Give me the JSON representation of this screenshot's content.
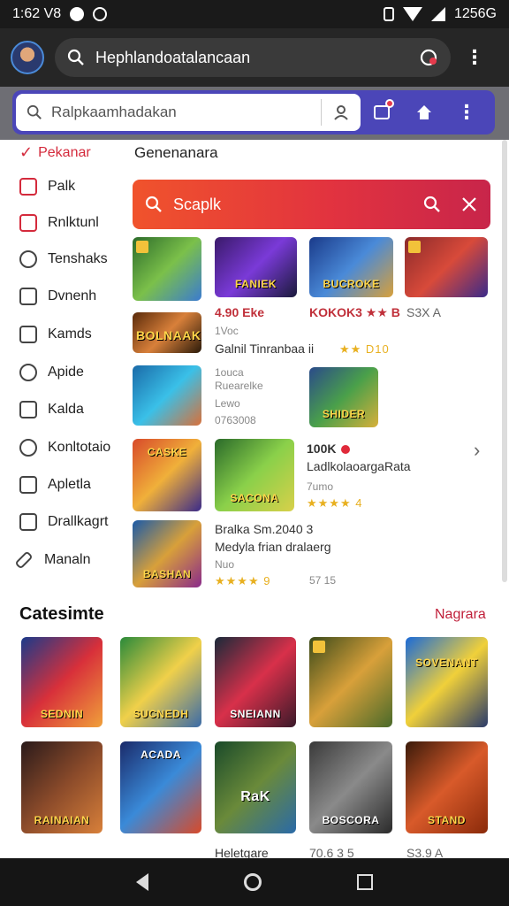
{
  "status_bar": {
    "time": "1:62 V8",
    "battery_time": "1256G"
  },
  "browser": {
    "url": "Hephlandoatalancaan"
  },
  "app_bar": {
    "search_placeholder": "Ralpkaamhadakan"
  },
  "sidebar": {
    "items": [
      {
        "label": "Pekanar",
        "icon": "check-icon",
        "active": true
      },
      {
        "label": "Palk",
        "icon": "bag-icon"
      },
      {
        "label": "Rnlktunl",
        "icon": "calendar-icon"
      },
      {
        "label": "Tenshaks",
        "icon": "chat-icon"
      },
      {
        "label": "Dvnenh",
        "icon": "list-icon"
      },
      {
        "label": "Kamds",
        "icon": "bag-icon"
      },
      {
        "label": "Apide",
        "icon": "clock-icon"
      },
      {
        "label": "Kalda",
        "icon": "square-icon"
      },
      {
        "label": "Konltotaio",
        "icon": "link-icon"
      },
      {
        "label": "Apletla",
        "icon": "square-icon"
      },
      {
        "label": "Drallkagrt",
        "icon": "grid-icon"
      },
      {
        "label": "Manaln",
        "icon": "pencil-icon"
      }
    ]
  },
  "main": {
    "title": "Genenanara",
    "red_search": {
      "text": "Scaplk"
    },
    "top_row": {
      "tiles": [
        {
          "caption": ""
        },
        {
          "caption": "FANIEK"
        },
        {
          "caption": "BUCROKE"
        },
        {
          "caption": ""
        }
      ],
      "meta": [
        "4.90 Eke",
        "KOKOK3 ★★ B",
        "S3X A"
      ]
    },
    "rows": [
      {
        "title": "Galnil Tinranbaa ii",
        "sub": "1Voc",
        "rating": "★★ D10",
        "tile_caption": "BOLNAAK"
      },
      {
        "title": "1ouca",
        "sub": "Ruearelke",
        "extra": "Lewo",
        "extra2": "0763008",
        "tile_caption": "SHIDER"
      },
      {
        "title": "100K",
        "sub": "LadlkolaoargaRata",
        "extra": "7umo",
        "rating": "★★★★ 4",
        "tile_caption_1": "CASKE",
        "tile_caption_2": "SACONA"
      },
      {
        "title": "Bralka Sm.2040 3",
        "sub": "Medyla frian dralaerg",
        "extra": "Nuo",
        "rating": "★★★★ 9",
        "extra2": "57 15",
        "tile_caption": "BASHAN"
      }
    ]
  },
  "section": {
    "title": "Catesimte",
    "link": "Nagrara",
    "tiles": [
      {
        "caption": "SEDNIN"
      },
      {
        "caption": "SUCNEDH"
      },
      {
        "caption": "SNEIANN"
      },
      {
        "caption": ""
      },
      {
        "caption": "SOVENANT"
      },
      {
        "caption": "RAINAIAN"
      },
      {
        "caption": "ACADA"
      },
      {
        "caption": "RaK"
      },
      {
        "caption": "BOSCORA"
      },
      {
        "caption": "STAND"
      }
    ],
    "bottom_meta": [
      "Heletgare",
      "70.6 3 5",
      "S3.9 A"
    ]
  },
  "colors": {
    "accent": "#d42a3c",
    "app_bar": "#4b46b8"
  }
}
